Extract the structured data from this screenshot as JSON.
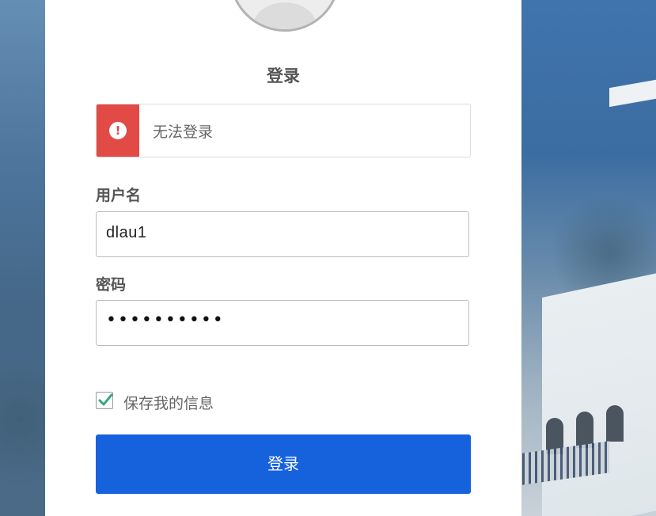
{
  "login": {
    "title": "登录",
    "alert_message": "无法登录",
    "username_label": "用户名",
    "username_value": "dlau1",
    "password_label": "密码",
    "password_value": "••••••••••",
    "remember_label": "保存我的信息",
    "remember_checked": true,
    "submit_label": "登录"
  },
  "icons": {
    "alert": "exclamation-circle-icon",
    "checkbox": "checkmark-icon"
  },
  "colors": {
    "alert_red": "#e24a45",
    "primary_blue": "#1662dd",
    "check_green": "#3aa583"
  }
}
